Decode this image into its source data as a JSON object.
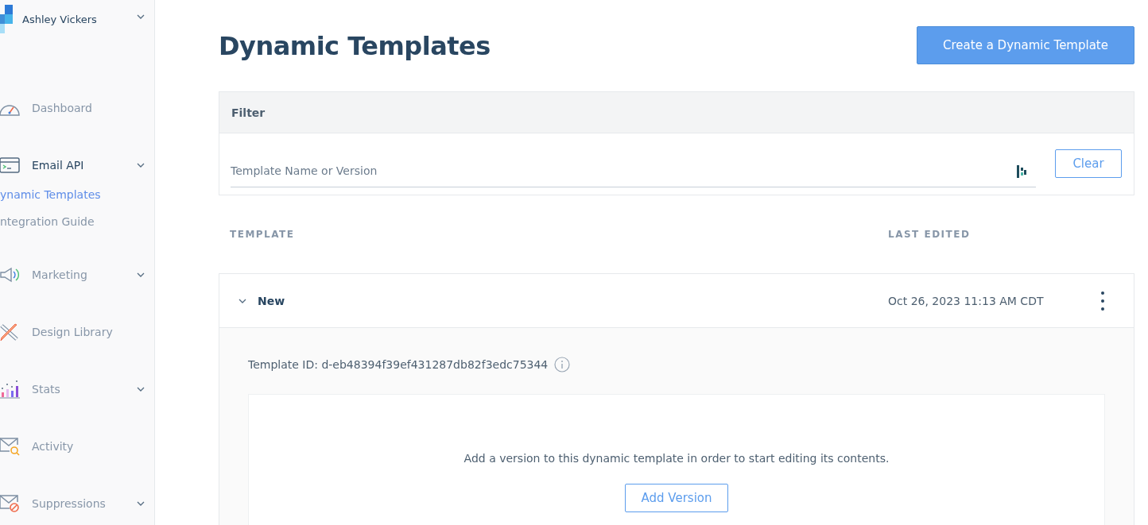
{
  "account": {
    "name": "Ashley Vickers"
  },
  "sidebar": {
    "items": [
      {
        "kind": "dashboard",
        "label": "Dashboard",
        "expandable": false
      },
      {
        "kind": "email",
        "label": "Email API",
        "expandable": true,
        "children": [
          {
            "label": "ynamic Templates",
            "selected": true
          },
          {
            "label": "ntegration Guide",
            "selected": false
          }
        ]
      },
      {
        "kind": "marketing",
        "label": "Marketing",
        "expandable": true
      },
      {
        "kind": "design",
        "label": "Design Library",
        "expandable": false
      },
      {
        "kind": "stats",
        "label": "Stats",
        "expandable": true
      },
      {
        "kind": "activity",
        "label": "Activity",
        "expandable": false
      },
      {
        "kind": "suppressions",
        "label": "Suppressions",
        "expandable": true
      }
    ]
  },
  "page": {
    "title": "Dynamic Templates",
    "create_button": "Create a Dynamic Template"
  },
  "filter": {
    "title": "Filter",
    "placeholder": "Template Name or Version",
    "clear_button": "Clear"
  },
  "table": {
    "columns": [
      "TEMPLATE",
      "LAST EDITED"
    ],
    "rows": [
      {
        "name": "New",
        "last_edited": "Oct 26, 2023 11:13 AM CDT",
        "expanded": true,
        "template_id": "Template ID: d-eb48394f39ef431287db82f3edc75344",
        "empty_message": "Add a version to this dynamic template in order to start editing its contents.",
        "add_button": "Add Version"
      }
    ]
  }
}
